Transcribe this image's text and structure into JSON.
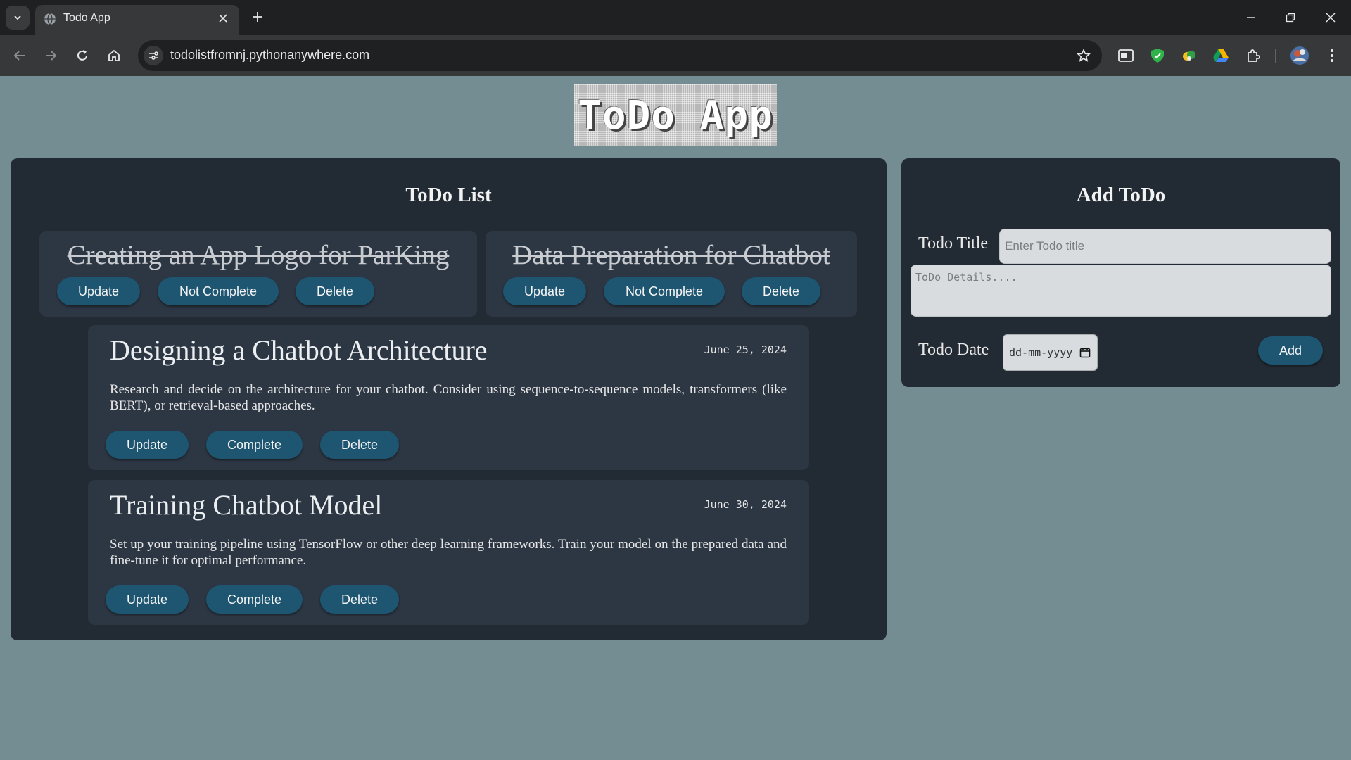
{
  "browser": {
    "tab_title": "Todo App",
    "url": "todolistfromnj.pythonanywhere.com"
  },
  "logo_text": "ToDo App",
  "todo_list": {
    "heading": "ToDo List",
    "completed": [
      {
        "title": "Creating an App Logo for ParKing",
        "update": "Update",
        "toggle": "Not Complete",
        "delete": "Delete"
      },
      {
        "title": "Data Preparation for Chatbot",
        "update": "Update",
        "toggle": "Not Complete",
        "delete": "Delete"
      }
    ],
    "pending": [
      {
        "title": "Designing a Chatbot Architecture",
        "date": "June 25, 2024",
        "description": "Research and decide on the architecture for your chatbot. Consider using sequence-to-sequence models, transformers (like BERT), or retrieval-based approaches.",
        "update": "Update",
        "toggle": "Complete",
        "delete": "Delete"
      },
      {
        "title": "Training Chatbot Model",
        "date": "June 30, 2024",
        "description": "Set up your training pipeline using TensorFlow or other deep learning frameworks. Train your model on the prepared data and fine-tune it for optimal performance.",
        "update": "Update",
        "toggle": "Complete",
        "delete": "Delete"
      }
    ]
  },
  "add_todo": {
    "heading": "Add ToDo",
    "title_label": "Todo Title",
    "title_placeholder": "Enter Todo title",
    "details_placeholder": "ToDo Details....",
    "date_label": "Todo Date",
    "date_placeholder": "dd-mm-yyyy",
    "add_button": "Add"
  },
  "colors": {
    "page_bg": "#738d92",
    "panel_bg": "#222a33",
    "card_bg": "#2d3744",
    "button_bg": "#1e5672"
  },
  "icons": [
    "tab-search-icon",
    "globe-icon",
    "close-icon",
    "plus-icon",
    "minimize-icon",
    "restore-icon",
    "back-icon",
    "forward-icon",
    "reload-icon",
    "home-icon",
    "site-settings-icon",
    "star-icon",
    "extensions-icon",
    "profile-avatar-icon",
    "more-menu-icon",
    "calendar-icon"
  ]
}
